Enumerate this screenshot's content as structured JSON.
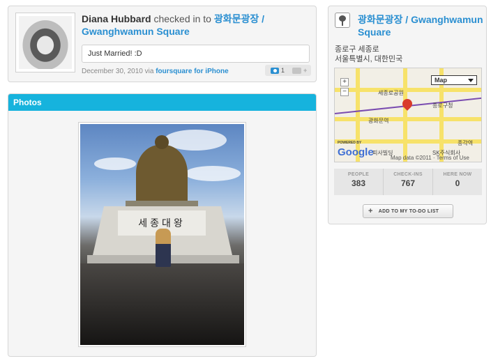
{
  "checkin": {
    "user_name": "Diana Hubbard",
    "action_text": "checked in to",
    "venue_link": "광화문광장 / Gwanghwamun Square",
    "shout": "Just Married! :D",
    "date": "December 30, 2010 via",
    "via_app": "foursquare for iPhone",
    "photo_count": "1",
    "comment_plus": "+"
  },
  "photos": {
    "title": "Photos",
    "plaque_text": "세종대왕"
  },
  "venue": {
    "name": "광화문광장 / Gwanghwamun Square",
    "address_line1": "종로구 세종로",
    "address_line2": "서울특별시, 대한민국",
    "map": {
      "type_select": "Map",
      "zoom_in": "+",
      "zoom_out": "−",
      "labels": [
        "세종로공원",
        "종로구청",
        "광화문역",
        "피사빌딩",
        "SK주식회사",
        "종각역"
      ],
      "powered_by": "POWERED BY",
      "logo": "Google",
      "credit": "Map data ©2011 · Terms of Use"
    },
    "stats": [
      {
        "label": "PEOPLE",
        "value": "383"
      },
      {
        "label": "CHECK-INS",
        "value": "767"
      },
      {
        "label": "HERE NOW",
        "value": "0"
      }
    ],
    "todo_button": "ADD TO MY TO-DO LIST",
    "todo_plus": "+"
  },
  "colors": {
    "link": "#2a8fd1",
    "photos_header": "#16b3dd"
  }
}
